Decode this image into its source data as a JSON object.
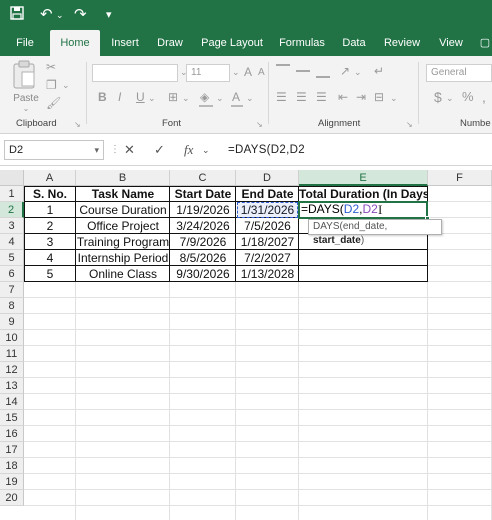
{
  "ribbon_tabs": [
    "File",
    "Home",
    "Insert",
    "Draw",
    "Page Layout",
    "Formulas",
    "Data",
    "Review",
    "View"
  ],
  "active_tab": "Home",
  "ribbon": {
    "paste_label": "Paste",
    "font_size": "11",
    "number_format": "General",
    "groups": {
      "clipboard": "Clipboard",
      "font": "Font",
      "alignment": "Alignment",
      "number": "Numbe"
    }
  },
  "formula_bar": {
    "name_box": "D2",
    "cancel_icon": "✕",
    "enter_icon": "✓",
    "fx_label": "fx",
    "formula": "=DAYS(D2,D2"
  },
  "columns": [
    "A",
    "B",
    "C",
    "D",
    "E",
    "F"
  ],
  "rows": [
    "1",
    "2",
    "3",
    "4",
    "5",
    "6",
    "7",
    "8",
    "9",
    "10",
    "11",
    "12",
    "13",
    "14",
    "15",
    "16",
    "17",
    "18",
    "19",
    "20"
  ],
  "table": {
    "headers": [
      "S. No.",
      "Task Name",
      "Start Date",
      "End Date",
      "Total Duration (In Days)"
    ],
    "rows": [
      [
        "1",
        "Course Duration",
        "1/19/2026",
        "1/31/2026"
      ],
      [
        "2",
        "Office Project",
        "3/24/2026",
        "7/5/2026"
      ],
      [
        "3",
        "Training Program",
        "7/9/2026",
        "1/18/2027"
      ],
      [
        "4",
        "Internship Period",
        "8/5/2026",
        "7/2/2027"
      ],
      [
        "5",
        "Online Class",
        "9/30/2026",
        "1/13/2028"
      ]
    ]
  },
  "editing_cell": {
    "prefix": "=DAYS(",
    "ref1": "D2",
    "comma": ",",
    "ref2": "D2"
  },
  "tooltip": {
    "func": "DAYS(",
    "arg1": "end_date, ",
    "arg2": "start_date",
    "close": ")"
  },
  "colors": {
    "excel_green": "#217346",
    "ref_blue": "#2f5fd0",
    "ref_purple": "#8a4dbd"
  }
}
